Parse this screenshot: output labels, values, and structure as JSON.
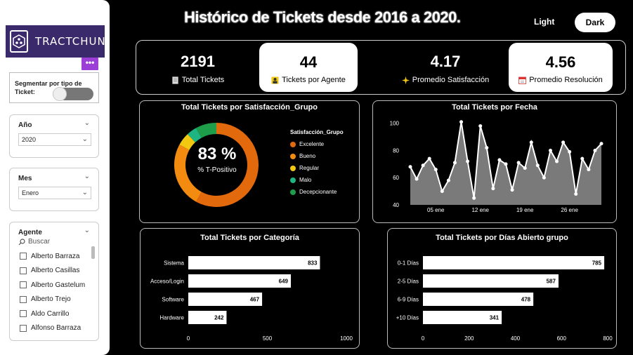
{
  "header": {
    "title": "Histórico de Tickets desde 2016 a 2020.",
    "theme_light": "Light",
    "theme_dark": "Dark"
  },
  "sidebar": {
    "logo_text": "TRACTCHUN",
    "more_button": "•••",
    "toggle_label": "Segmentar por tipo de Ticket:",
    "year": {
      "title": "Año",
      "value": "2020"
    },
    "month": {
      "title": "Mes",
      "value": "Enero"
    },
    "agent": {
      "title": "Agente",
      "search_placeholder": "Buscar",
      "items": [
        "Alberto Barraza",
        "Alberto Casillas",
        "Alberto Gastelum",
        "Alberto Trejo",
        "Aldo Carrillo",
        "Alfonso Barraza"
      ]
    }
  },
  "kpis": [
    {
      "value": "2191",
      "label": "Total Tickets",
      "icon": "document-icon"
    },
    {
      "value": "44",
      "label": "Tickets por Agente",
      "icon": "agent-icon"
    },
    {
      "value": "4.17",
      "label": "Promedio Satisfacción",
      "icon": "sparkle-icon"
    },
    {
      "value": "4.56",
      "label": "Promedio Resolución",
      "icon": "calendar-icon"
    }
  ],
  "colors": {
    "excelente": "#e3690d",
    "bueno": "#f28b10",
    "regular": "#f2c811",
    "malo": "#1fb582",
    "decepcionante": "#1e9e4a",
    "bar": "#ffffff",
    "area_fill": "#7a7a7a"
  },
  "chart_data": [
    {
      "type": "pie",
      "title": "Total Tickets por Satisfacción_Grupo",
      "center_value": "83 %",
      "center_label": "% T-Positivo",
      "legend_title": "Satisfacción_Grupo",
      "categories": [
        "Excelente",
        "Bueno",
        "Regular",
        "Malo",
        "Decepcionante"
      ],
      "values": [
        58,
        25,
        5,
        4,
        8
      ],
      "legend_position": "right"
    },
    {
      "type": "area",
      "title": "Total Tickets por Fecha",
      "x_ticks": [
        "05 ene",
        "12 ene",
        "19 ene",
        "26 ene"
      ],
      "y_ticks": [
        40,
        60,
        80,
        100
      ],
      "ylim": [
        40,
        105
      ],
      "x": [
        1,
        2,
        3,
        4,
        5,
        6,
        7,
        8,
        9,
        10,
        11,
        12,
        13,
        14,
        15,
        16,
        17,
        18,
        19,
        20,
        21,
        22,
        23,
        24,
        25,
        26,
        27,
        28,
        29,
        30,
        31
      ],
      "values": [
        68,
        59,
        69,
        74,
        66,
        50,
        58,
        71,
        101,
        72,
        45,
        98,
        82,
        52,
        73,
        70,
        51,
        71,
        67,
        86,
        69,
        60,
        80,
        72,
        86,
        79,
        48,
        74,
        66,
        80,
        85
      ],
      "grid": false
    },
    {
      "type": "bar",
      "title": "Total Tickets por Categoría",
      "categories": [
        "Sistema",
        "Acceso/Login",
        "Software",
        "Hardware"
      ],
      "values": [
        833,
        649,
        467,
        242
      ],
      "x_ticks": [
        0,
        500,
        1000
      ],
      "xlim": [
        0,
        1000
      ]
    },
    {
      "type": "bar",
      "title": "Total Tickets por Días Abierto grupo",
      "categories": [
        "0-1 Días",
        "2-5 Días",
        "6-9 Días",
        "+10 Días"
      ],
      "values": [
        785,
        587,
        478,
        341
      ],
      "x_ticks": [
        0,
        200,
        400,
        600,
        800
      ],
      "xlim": [
        0,
        800
      ]
    }
  ]
}
